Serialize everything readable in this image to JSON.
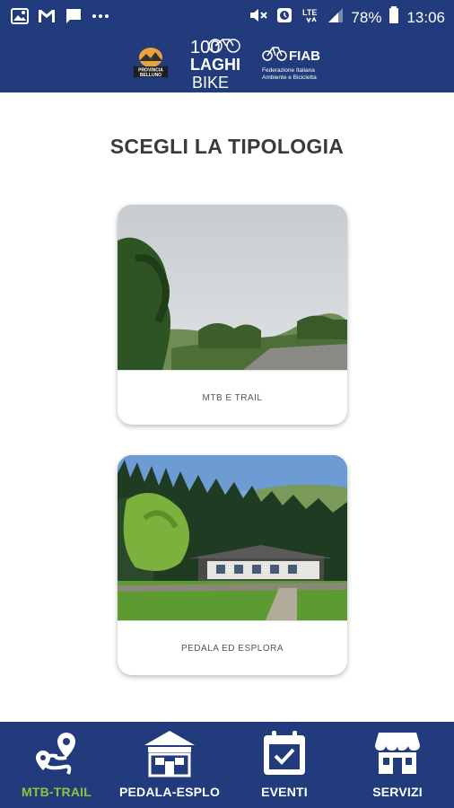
{
  "status_bar": {
    "battery": "78%",
    "time": "13:06",
    "network": "LTE",
    "icons": [
      "image-icon",
      "gmail-icon",
      "message-icon",
      "more-icon",
      "mute-icon",
      "alarm-icon",
      "lte-icon",
      "signal-icon",
      "battery-icon"
    ]
  },
  "header": {
    "logos": [
      "pm-logo",
      "100-laghi-bike-logo",
      "fiab-logo"
    ],
    "logo_100_top": "100",
    "logo_100_mid": "LAGHI",
    "logo_100_bottom": "BIKE",
    "fiab_name": "FIAB",
    "fiab_sub1": "Federazione Italiana",
    "fiab_sub2": "Ambiente e Bicicletta",
    "pm_text1": "PROVINCIA",
    "pm_text2": "BELLUNO"
  },
  "page_title": "SCEGLI LA TIPOLOGIA",
  "cards": [
    {
      "label": "MTB E TRAIL"
    },
    {
      "label": "PEDALA ED ESPLORA"
    }
  ],
  "bottom_nav": {
    "items": [
      {
        "label": "MTB-TRAIL",
        "icon": "route-icon",
        "active": true
      },
      {
        "label": "PEDALA-ESPLO",
        "icon": "building-icon",
        "active": false
      },
      {
        "label": "EVENTI",
        "icon": "calendar-check-icon",
        "active": false
      },
      {
        "label": "SERVIZI",
        "icon": "shop-icon",
        "active": false
      }
    ]
  },
  "colors": {
    "primary": "#213b7c",
    "active": "#8bc53f",
    "title": "#3a3a3a"
  }
}
